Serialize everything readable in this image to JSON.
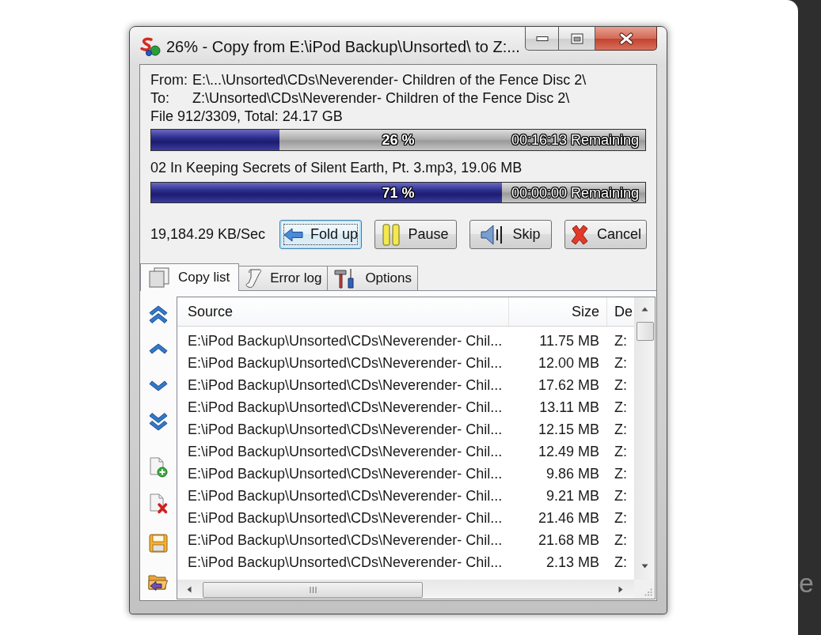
{
  "window": {
    "title": "26% - Copy from E:\\iPod Backup\\Unsorted\\ to Z:..."
  },
  "paths": [
    {
      "label": "From:",
      "value": "E:\\...\\Unsorted\\CDs\\Neverender- Children of the Fence Disc 2\\"
    },
    {
      "label": "To:",
      "value": "Z:\\Unsorted\\CDs\\Neverender- Children of the Fence Disc 2\\"
    }
  ],
  "file_count": "File 912/3309, Total: 24.17 GB",
  "overall_progress": {
    "level": 0.26,
    "percent": "26 %",
    "remaining": "00:16:13 Remaining"
  },
  "current_file": "02 In Keeping Secrets of Silent Earth, Pt. 3.mp3, 19.06 MB",
  "file_progress": {
    "level": 0.71,
    "percent": "71 %",
    "remaining": "00:00:00 Remaining"
  },
  "speed": "19,184.29 KB/Sec",
  "buttons": [
    {
      "label": "Fold up",
      "focused": true
    },
    {
      "label": "Pause",
      "focused": false
    },
    {
      "label": "Skip",
      "focused": false
    },
    {
      "label": "Cancel",
      "focused": false
    }
  ],
  "tabs": [
    {
      "label": "Copy list",
      "selected": true
    },
    {
      "label": "Error log",
      "selected": false
    },
    {
      "label": "Options",
      "selected": false
    }
  ],
  "copy_list": {
    "columns": [
      "Source",
      "Size",
      "De"
    ],
    "rows": [
      {
        "source": "E:\\iPod Backup\\Unsorted\\CDs\\Neverender- Chil...",
        "size": "11.75 MB",
        "column_3": "Z:"
      },
      {
        "source": "E:\\iPod Backup\\Unsorted\\CDs\\Neverender- Chil...",
        "size": "12.00 MB",
        "column_3": "Z:"
      },
      {
        "source": "E:\\iPod Backup\\Unsorted\\CDs\\Neverender- Chil...",
        "size": "17.62 MB",
        "column_3": "Z:"
      },
      {
        "source": "E:\\iPod Backup\\Unsorted\\CDs\\Neverender- Chil...",
        "size": "13.11 MB",
        "column_3": "Z:"
      },
      {
        "source": "E:\\iPod Backup\\Unsorted\\CDs\\Neverender- Chil...",
        "size": "12.15 MB",
        "column_3": "Z:"
      },
      {
        "source": "E:\\iPod Backup\\Unsorted\\CDs\\Neverender- Chil...",
        "size": "12.49 MB",
        "column_3": "Z:"
      },
      {
        "source": "E:\\iPod Backup\\Unsorted\\CDs\\Neverender- Chil...",
        "size": "9.86 MB",
        "column_3": "Z:"
      },
      {
        "source": "E:\\iPod Backup\\Unsorted\\CDs\\Neverender- Chil...",
        "size": "9.21 MB",
        "column_3": "Z:"
      },
      {
        "source": "E:\\iPod Backup\\Unsorted\\CDs\\Neverender- Chil...",
        "size": "21.46 MB",
        "column_3": "Z:"
      },
      {
        "source": "E:\\iPod Backup\\Unsorted\\CDs\\Neverender- Chil...",
        "size": "21.68 MB",
        "column_3": "Z:"
      },
      {
        "source": "E:\\iPod Backup\\Unsorted\\CDs\\Neverender- Chil...",
        "size": "2.13 MB",
        "column_3": "Z:"
      }
    ]
  },
  "side_text": "e"
}
